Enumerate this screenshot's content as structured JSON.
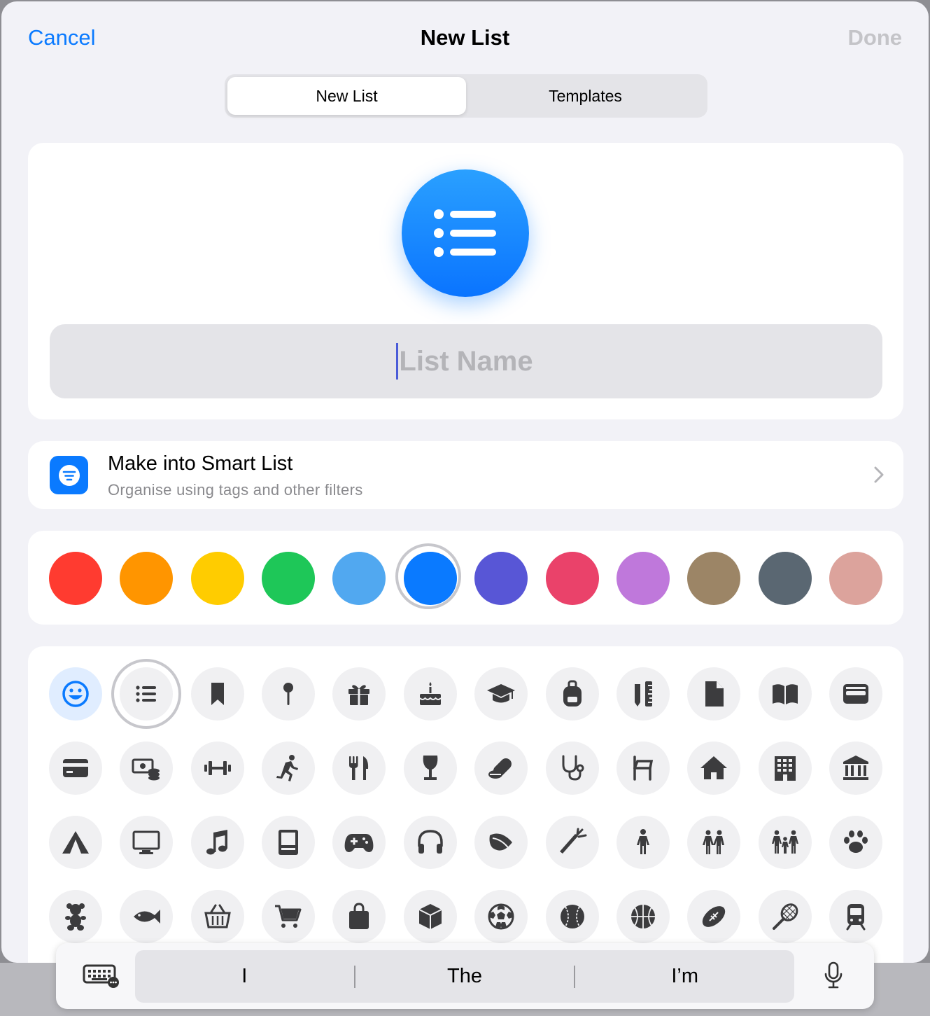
{
  "nav": {
    "cancel": "Cancel",
    "title": "New List",
    "done": "Done"
  },
  "tabs": [
    {
      "label": "New List",
      "active": true
    },
    {
      "label": "Templates",
      "active": false
    }
  ],
  "list_name": {
    "value": "",
    "placeholder": "List Name"
  },
  "smart_list": {
    "title": "Make into Smart List",
    "subtitle": "Organise using tags and other filters"
  },
  "colors": [
    {
      "name": "red",
      "hex": "#ff3b30"
    },
    {
      "name": "orange",
      "hex": "#ff9500"
    },
    {
      "name": "yellow",
      "hex": "#ffcc00"
    },
    {
      "name": "green",
      "hex": "#1ec758"
    },
    {
      "name": "light-blue",
      "hex": "#51a8f0"
    },
    {
      "name": "blue",
      "hex": "#0a7aff",
      "selected": true
    },
    {
      "name": "indigo",
      "hex": "#5856d6"
    },
    {
      "name": "pink",
      "hex": "#ea426a"
    },
    {
      "name": "purple",
      "hex": "#bf78db"
    },
    {
      "name": "brown",
      "hex": "#9c8566"
    },
    {
      "name": "gray",
      "hex": "#5a6772"
    },
    {
      "name": "rose",
      "hex": "#dca39c"
    }
  ],
  "selected_color": "#0a7aff",
  "icons": [
    "smiley-icon",
    "list-icon",
    "bookmark-icon",
    "pin-icon",
    "gift-icon",
    "birthday-cake-icon",
    "graduation-cap-icon",
    "backpack-icon",
    "pencil-ruler-icon",
    "document-icon",
    "book-icon",
    "wallet-icon",
    "credit-card-icon",
    "money-icon",
    "dumbbell-icon",
    "running-person-icon",
    "fork-knife-icon",
    "wine-glass-icon",
    "pills-icon",
    "stethoscope-icon",
    "chair-icon",
    "house-icon",
    "building-icon",
    "bank-icon",
    "tent-icon",
    "desktop-icon",
    "music-note-icon",
    "computer-icon",
    "gamecontroller-icon",
    "headphones-icon",
    "leaf-icon",
    "carrot-icon",
    "person-icon",
    "two-people-icon",
    "family-icon",
    "paw-icon",
    "teddy-bear-icon",
    "fish-icon",
    "basket-icon",
    "cart-icon",
    "shopping-bag-icon",
    "box-icon",
    "soccer-ball-icon",
    "baseball-icon",
    "basketball-icon",
    "football-icon",
    "tennis-racket-icon",
    "train-icon"
  ],
  "selected_icon": "list-icon",
  "keyboard": {
    "suggestions": [
      "I",
      "The",
      "I’m"
    ]
  }
}
